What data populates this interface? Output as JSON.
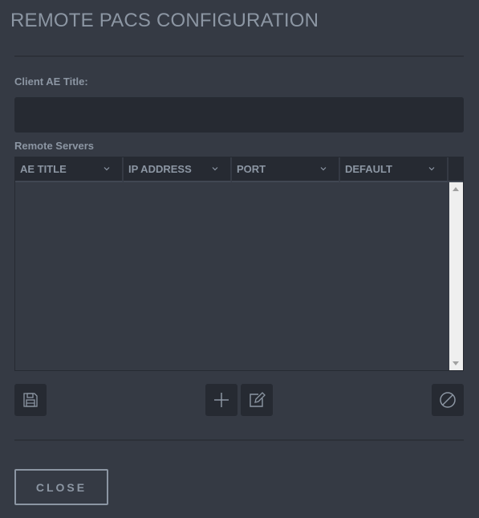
{
  "dialog": {
    "title": "REMOTE PACS CONFIGURATION",
    "client_ae_label": "Client AE Title:",
    "client_ae_value": "",
    "remote_servers_label": "Remote Servers",
    "columns": [
      {
        "label": "AE TITLE",
        "icon": "chevron-down-icon"
      },
      {
        "label": "IP ADDRESS",
        "icon": "chevron-down-icon"
      },
      {
        "label": "PORT",
        "icon": "chevron-down-icon"
      },
      {
        "label": "DEFAULT",
        "icon": "chevron-down-icon"
      }
    ],
    "rows": [],
    "buttons": {
      "save": {
        "icon": "floppy-disk-icon"
      },
      "add": {
        "icon": "plus-icon"
      },
      "edit": {
        "icon": "edit-pencil-icon"
      },
      "delete": {
        "icon": "ban-icon"
      },
      "close_label": "CLOSE"
    }
  }
}
